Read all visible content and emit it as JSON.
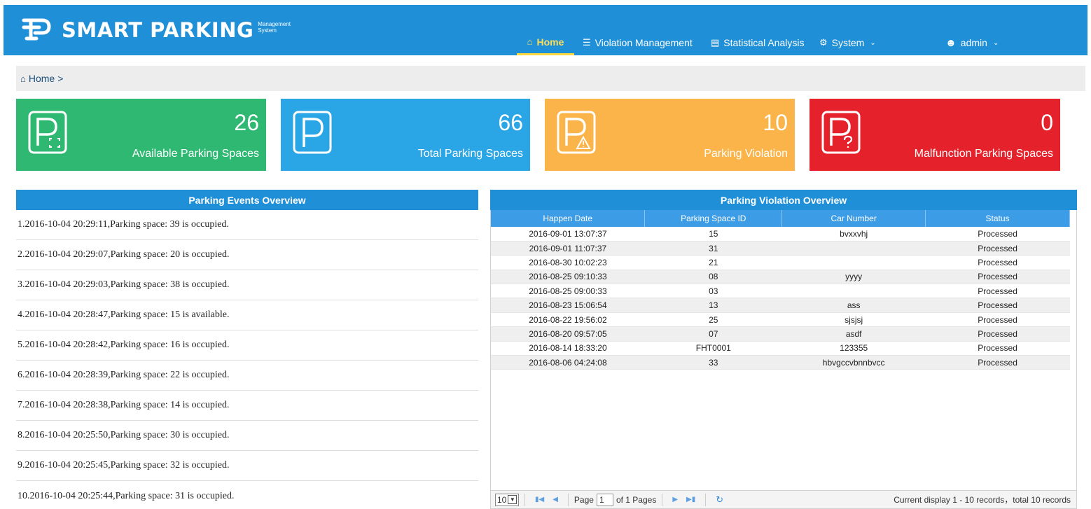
{
  "header": {
    "title": "SMART PARKING",
    "subtitle_line1": "Management",
    "subtitle_line2": "System",
    "nav": {
      "home": "Home",
      "violation": "Violation Management",
      "statistical": "Statistical Analysis",
      "system": "System",
      "user": "admin"
    }
  },
  "breadcrumb": {
    "home": "Home",
    "sep": ">"
  },
  "cards": [
    {
      "value": "26",
      "label": "Available Parking Spaces",
      "color": "#2eb872"
    },
    {
      "value": "66",
      "label": "Total Parking Spaces",
      "color": "#2aa5e5"
    },
    {
      "value": "10",
      "label": "Parking Violation",
      "color": "#fbb44a"
    },
    {
      "value": "0",
      "label": "Malfunction Parking Spaces",
      "color": "#e5222b"
    }
  ],
  "events_panel": {
    "title": "Parking Events Overview",
    "items": [
      "1.2016-10-04 20:29:11,Parking space: 39 is occupied.",
      "2.2016-10-04 20:29:07,Parking space: 20 is occupied.",
      "3.2016-10-04 20:29:03,Parking space: 38 is occupied.",
      "4.2016-10-04 20:28:47,Parking space: 15 is available.",
      "5.2016-10-04 20:28:42,Parking space: 16 is occupied.",
      "6.2016-10-04 20:28:39,Parking space: 22 is occupied.",
      "7.2016-10-04 20:28:38,Parking space: 14 is occupied.",
      "8.2016-10-04 20:25:50,Parking space: 30 is occupied.",
      "9.2016-10-04 20:25:45,Parking space: 32 is occupied.",
      "10.2016-10-04 20:25:44,Parking space: 31 is occupied."
    ]
  },
  "violations_panel": {
    "title": "Parking Violation Overview",
    "columns": [
      "Happen Date",
      "Parking Space ID",
      "Car Number",
      "Status"
    ],
    "rows": [
      [
        "2016-09-01 13:07:37",
        "15",
        "bvxxvhj",
        "Processed"
      ],
      [
        "2016-09-01 11:07:37",
        "31",
        "",
        "Processed"
      ],
      [
        "2016-08-30 10:02:23",
        "21",
        "",
        "Processed"
      ],
      [
        "2016-08-25 09:10:33",
        "08",
        "yyyy",
        "Processed"
      ],
      [
        "2016-08-25 09:00:33",
        "03",
        "",
        "Processed"
      ],
      [
        "2016-08-23 15:06:54",
        "13",
        "ass",
        "Processed"
      ],
      [
        "2016-08-22 19:56:02",
        "25",
        "sjsjsj",
        "Processed"
      ],
      [
        "2016-08-20 09:57:05",
        "07",
        "asdf",
        "Processed"
      ],
      [
        "2016-08-14 18:33:20",
        "FHT0001",
        "123355",
        "Processed"
      ],
      [
        "2016-08-06 04:24:08",
        "33",
        "hbvgccvbnnbvcc",
        "Processed"
      ]
    ]
  },
  "pager": {
    "page_size": "10",
    "page_label": "Page",
    "page_value": "1",
    "of_pages": "of 1 Pages",
    "info": "Current display 1 - 10 records，total 10 records"
  }
}
